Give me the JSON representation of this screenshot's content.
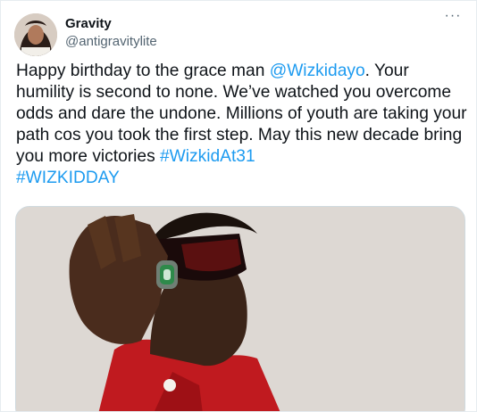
{
  "author": {
    "display_name": "Gravity",
    "handle": "@antigravitylite"
  },
  "tweet": {
    "text_1": "Happy birthday to the grace man ",
    "mention": "@Wizkidayo",
    "text_2": ". Your humility is second to none. We’ve watched you overcome odds and dare the undone. Millions of youth are taking your path cos you took the first step. May this new decade bring you more victories ",
    "hashtag_1": "#WizkidAt31",
    "hashtag_2": "#WIZKIDDAY"
  },
  "more_menu": {
    "label": "···"
  },
  "icons": {
    "avatar": "profile-photo",
    "more": "more-dots-icon"
  },
  "colors": {
    "link": "#1d9bf0",
    "text": "#0f1419",
    "secondary": "#536471"
  }
}
